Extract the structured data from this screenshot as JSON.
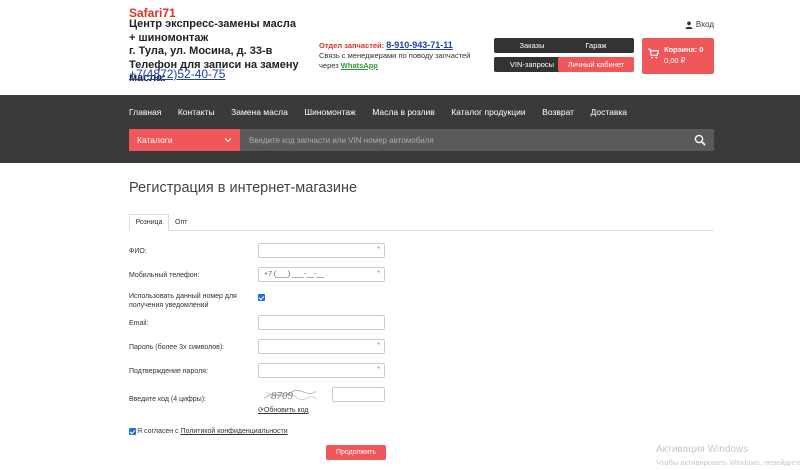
{
  "header": {
    "shop_name": "Safari71",
    "subtitle_lines": [
      "Центр экспресс-замены масла",
      "+ шиномонтаж",
      "г. Тула, ул. Мосина, д. 33-в",
      "Телефон для записи на замену масла:"
    ],
    "phone": "+7(4872)52-40-75",
    "parts_label": "Отдел запчастей:",
    "parts_phone": "8-910-943-71-11",
    "parts_line2": "Связь с менеджерами по поводу запчастей",
    "parts_line3": "через",
    "whatsapp": "WhatsApp",
    "login": "Вход",
    "buttons": {
      "orders": "Заказы",
      "garage": "Гараж",
      "vin": "VIN-запросы",
      "cabinet": "Личный кабинет"
    },
    "cart": {
      "title": "Корзина: 0",
      "sum": "0,00 ₽"
    }
  },
  "nav": {
    "menu": [
      "Главная",
      "Контакты",
      "Замена масла",
      "Шиномонтаж",
      "Масла в розлив",
      "Каталог продукции",
      "Возврат",
      "Доставка"
    ],
    "catalog": "Каталоги",
    "search_placeholder": "Введите код запчасти или VIN номер автомобиля"
  },
  "main": {
    "title": "Регистрация в интернет-магазине",
    "tabs": [
      "Розница",
      "Опт"
    ],
    "fields": {
      "fio": "ФИО:",
      "mobile": "Мобильный телефон:",
      "mobile_value": "+7 (___) ___-__-__",
      "use_number_line1": "Использовать данный номер для",
      "use_number_line2": "получения уведомлений",
      "email": "Email:",
      "password": "Пароль (более 3х символов):",
      "confirm": "Подтверждение пароля:",
      "code": "Введите код (4 цифры):",
      "captcha_text": "8709",
      "refresh": "Обновить код"
    },
    "agree_prefix": "Я согласен с",
    "agree_link": "Политикой конфиденциальности",
    "submit": "Продолжить",
    "required_mark": "*"
  },
  "watermark": {
    "title": "Активация Windows",
    "sub": "Чтобы активировать Windows, перейдите"
  },
  "colors": {
    "accent": "#f0575b",
    "dark": "#3a3a3a",
    "brand_red": "#e0301e",
    "link_blue": "#1a3fb8"
  }
}
